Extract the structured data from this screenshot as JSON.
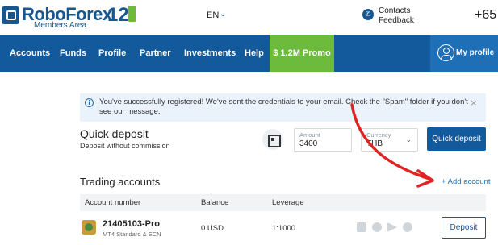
{
  "header": {
    "brand": "RoboForex",
    "brand_version": "12",
    "brand_sub": "Members Area",
    "language": "EN",
    "contacts_line1": "Contacts",
    "contacts_line2": "Feedback",
    "phone_partial": "+65"
  },
  "nav": {
    "items": [
      "Accounts",
      "Funds",
      "Profile",
      "Partner",
      "Investments",
      "Help"
    ],
    "promo": "$ 1.2M Promo",
    "profile": "My profile"
  },
  "alert": {
    "text": "You've successfully registered! We've sent the credentials to your email. Check the \"Spam\" folder if you don't see our message."
  },
  "quick_deposit": {
    "title": "Quick deposit",
    "subtitle": "Deposit without commission",
    "amount_label": "Amount",
    "amount_value": "3400",
    "currency_label": "Currency",
    "currency_value": "THB",
    "button": "Quick deposit"
  },
  "trading_accounts": {
    "title": "Trading accounts",
    "add_account": "+ Add account",
    "columns": [
      "Account number",
      "Balance",
      "Leverage"
    ],
    "rows": [
      {
        "number": "21405103-Pro",
        "type": "MT4 Standard & ECN",
        "balance": "0 USD",
        "leverage": "1:1000",
        "platform_icons": [
          "windows-icon",
          "globe-icon",
          "android-icon",
          "apple-icon"
        ],
        "action": "Deposit"
      }
    ]
  },
  "colors": {
    "brand_blue": "#135a9c",
    "promo_green": "#6cbb3c",
    "annotation_red": "#e02424"
  }
}
